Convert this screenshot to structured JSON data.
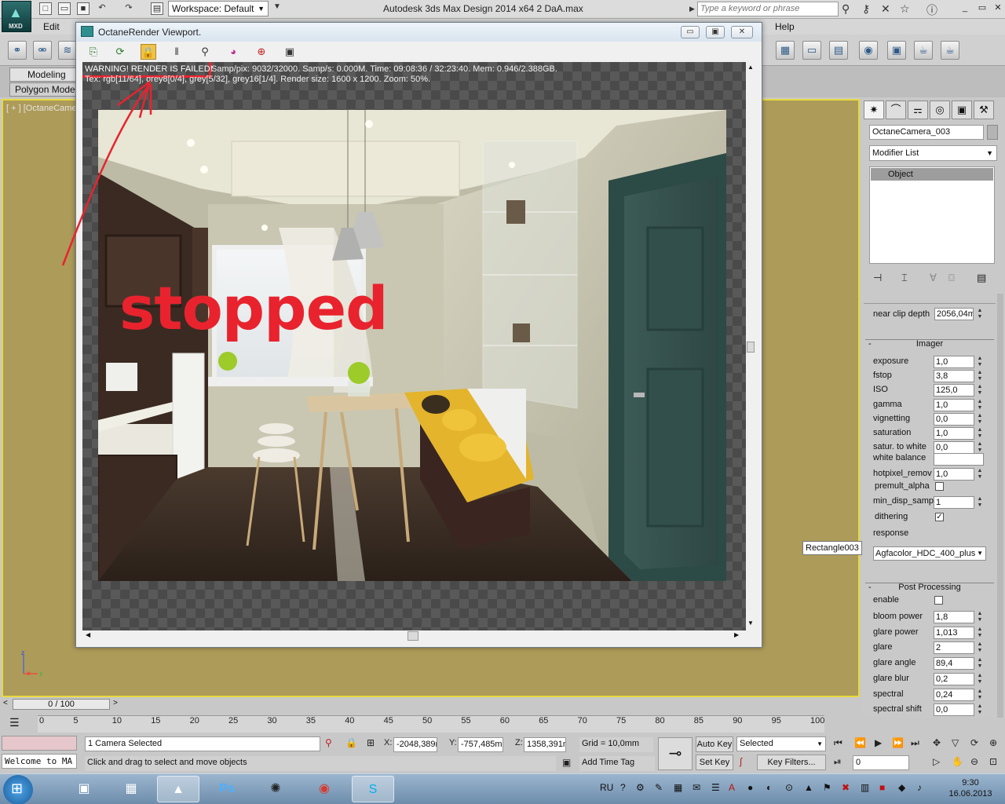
{
  "app": {
    "title": "Autodesk 3ds Max Design 2014 x64      2 DaA.max",
    "logo_text": "MXD",
    "workspace": "Workspace: Default",
    "search_placeholder": "Type a keyword or phrase"
  },
  "menu": {
    "items": [
      "Edit",
      "Help"
    ]
  },
  "ribbon": {
    "tabs": [
      "Modeling",
      "Polygon Mode"
    ]
  },
  "viewport": {
    "label": "[ + ] [OctaneCamer"
  },
  "octane": {
    "window_title": "OctaneRender Viewport.",
    "warning": "WARNING! RENDER IS FAILED!",
    "stats_line1": "Samp/pix: 9032/32000.   Samp/s: 0.000M.   Time: 09:08:36 / 32:23:40.   Mem: 0.946/2.388GB.",
    "stats_line2": "Tex: rgb[11/64], grey8[0/4], grey[5/32], grey16[1/4].   Render size: 1600 x 1200.   Zoom: 50%.",
    "annotation": "stopped"
  },
  "command_panel": {
    "object_name": "OctaneCamera_003",
    "modifier_list": "Modifier List",
    "stack_item": "Object",
    "near_clip_label": "near clip depth",
    "near_clip_value": "2056,04m",
    "imager": {
      "title": "Imager",
      "params": [
        {
          "label": "exposure",
          "value": "1,0"
        },
        {
          "label": "fstop",
          "value": "3,8"
        },
        {
          "label": "ISO",
          "value": "125,0"
        },
        {
          "label": "gamma",
          "value": "1,0"
        },
        {
          "label": "vignetting",
          "value": "0,0"
        },
        {
          "label": "saturation",
          "value": "1,0"
        },
        {
          "label": "satur. to white",
          "value": "0,0"
        }
      ],
      "white_balance_label": "white balance",
      "hotpixel_label": "hotpixel_remov",
      "hotpixel_value": "1,0",
      "premult_label": "premult_alpha",
      "min_disp_label": "min_disp_samp.",
      "min_disp_value": "1",
      "dithering_label": "dithering",
      "response_label": "response",
      "response_value": "Agfacolor_HDC_400_plus"
    },
    "post": {
      "title": "Post Processing",
      "enable_label": "enable",
      "params": [
        {
          "label": "bloom power",
          "value": "1,8"
        },
        {
          "label": "glare power",
          "value": "1,013"
        },
        {
          "label": "glare",
          "value": "2"
        },
        {
          "label": "glare angle",
          "value": "89,4"
        },
        {
          "label": "glare blur",
          "value": "0,2"
        },
        {
          "label": "spectral",
          "value": "0,24"
        },
        {
          "label": "spectral shift",
          "value": "0,0"
        }
      ]
    }
  },
  "tooltip": "Rectangle003",
  "timeline": {
    "slider": "0 / 100",
    "ticks": [
      "0",
      "5",
      "10",
      "15",
      "20",
      "25",
      "30",
      "35",
      "40",
      "45",
      "50",
      "55",
      "60",
      "65",
      "70",
      "75",
      "80",
      "85",
      "90",
      "95",
      "100"
    ]
  },
  "status": {
    "maxscript": "Welcome to MA",
    "selection": "1 Camera Selected",
    "prompt": "Click and drag to select and move objects",
    "x_label": "X:",
    "x": "-2048,389r",
    "y_label": "Y:",
    "y": "-757,485m",
    "z_label": "Z:",
    "z": "1358,391m",
    "grid": "Grid = 10,0mm",
    "add_time_tag": "Add Time Tag",
    "auto_key": "Auto Key",
    "set_key": "Set Key",
    "selected": "Selected",
    "key_filters": "Key Filters...",
    "frame": "0"
  },
  "taskbar": {
    "lang": "RU",
    "time": "9:30",
    "date": "16.06.2013",
    "apps": [
      "3ds Max",
      "Photoshop",
      "Chrome",
      "Skype"
    ]
  }
}
